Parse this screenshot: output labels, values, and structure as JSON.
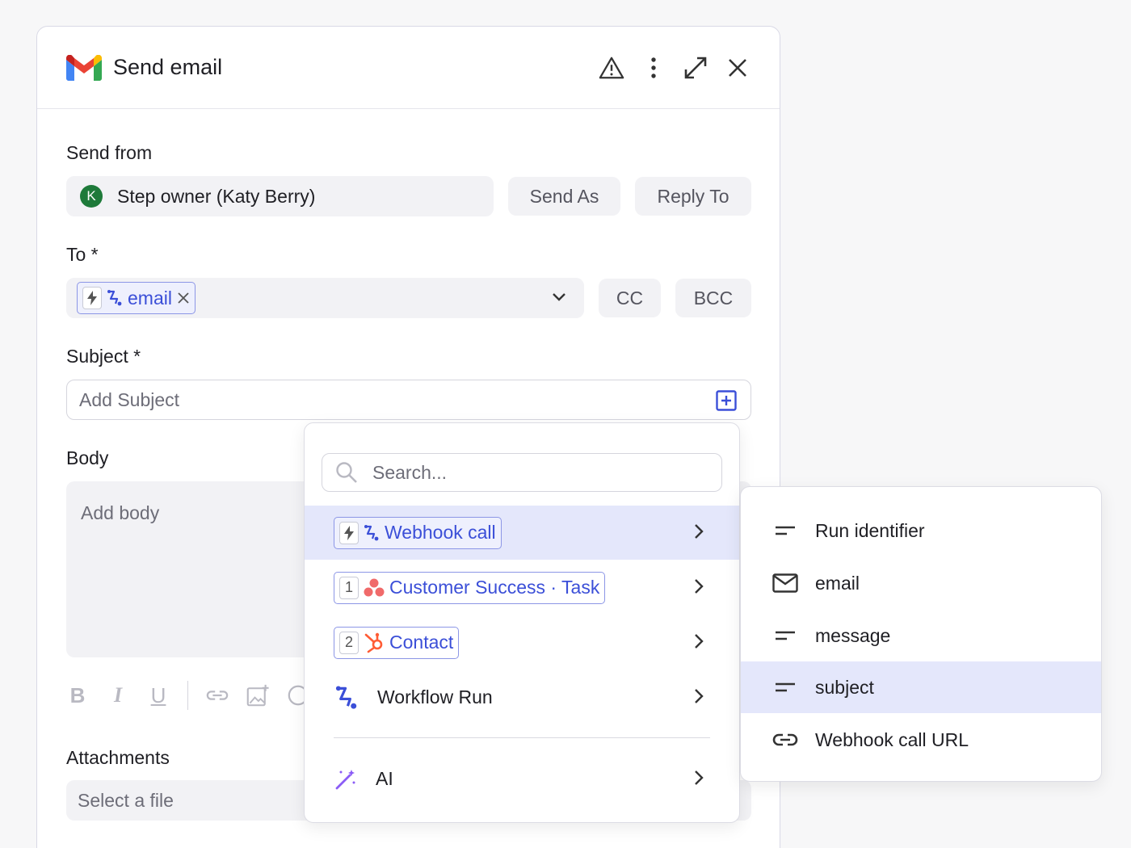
{
  "header": {
    "title": "Send email"
  },
  "send_from": {
    "label": "Send from",
    "avatar_letter": "K",
    "value": "Step owner (Katy Berry)",
    "send_as": "Send As",
    "reply_to": "Reply To"
  },
  "to": {
    "label": "To *",
    "token": "email",
    "cc": "CC",
    "bcc": "BCC"
  },
  "subject": {
    "label": "Subject *",
    "placeholder": "Add Subject"
  },
  "body": {
    "label": "Body",
    "placeholder": "Add body"
  },
  "attachments": {
    "label": "Attachments",
    "placeholder": "Select a file"
  },
  "toolbar": {
    "bold": "B",
    "italic": "I",
    "underline": "U"
  },
  "dropdown": {
    "search_placeholder": "Search...",
    "items": [
      {
        "label": "Webhook call"
      },
      {
        "num": "1",
        "label": "Customer Success · Task"
      },
      {
        "num": "2",
        "label": "Contact"
      },
      {
        "label": "Workflow Run"
      },
      {
        "label": "AI"
      }
    ]
  },
  "submenu": {
    "items": [
      {
        "label": "Run identifier",
        "icon": "text-lines-icon"
      },
      {
        "label": "email",
        "icon": "envelope-icon"
      },
      {
        "label": "message",
        "icon": "text-lines-icon"
      },
      {
        "label": "subject",
        "icon": "text-lines-icon"
      },
      {
        "label": "Webhook call URL",
        "icon": "link-icon"
      }
    ]
  },
  "colors": {
    "accent": "#3b4fd8",
    "active_row": "#e4e7fb",
    "avatar": "#1e7a3a"
  }
}
